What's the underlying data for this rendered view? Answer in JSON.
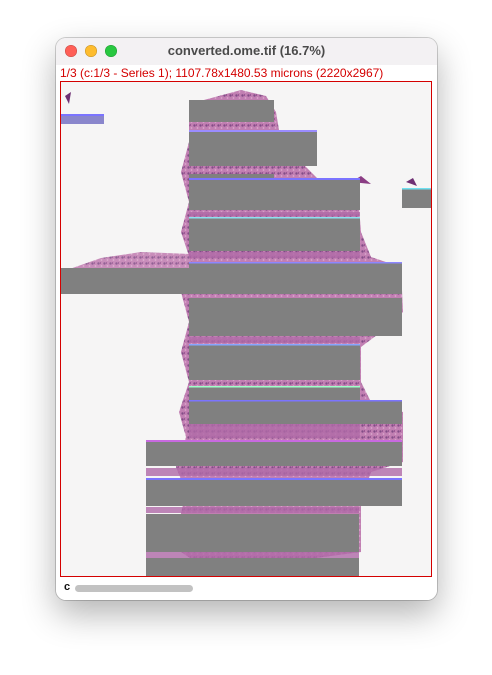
{
  "window": {
    "title": "converted.ome.tif (16.7%)",
    "info_line": "1/3 (c:1/3 - Series 1); 1107.78x1480.53 microns (2220x2967)"
  },
  "channel_slider": {
    "label": "c"
  },
  "colors": {
    "info_text": "#d40000",
    "canvas_border": "#d40000",
    "tissue": "#a35a9b",
    "tile_gray": "#808080",
    "tile_edge_accent": "#7b74ff"
  },
  "image_content": {
    "description_name": "histology-slide-mosaic"
  }
}
